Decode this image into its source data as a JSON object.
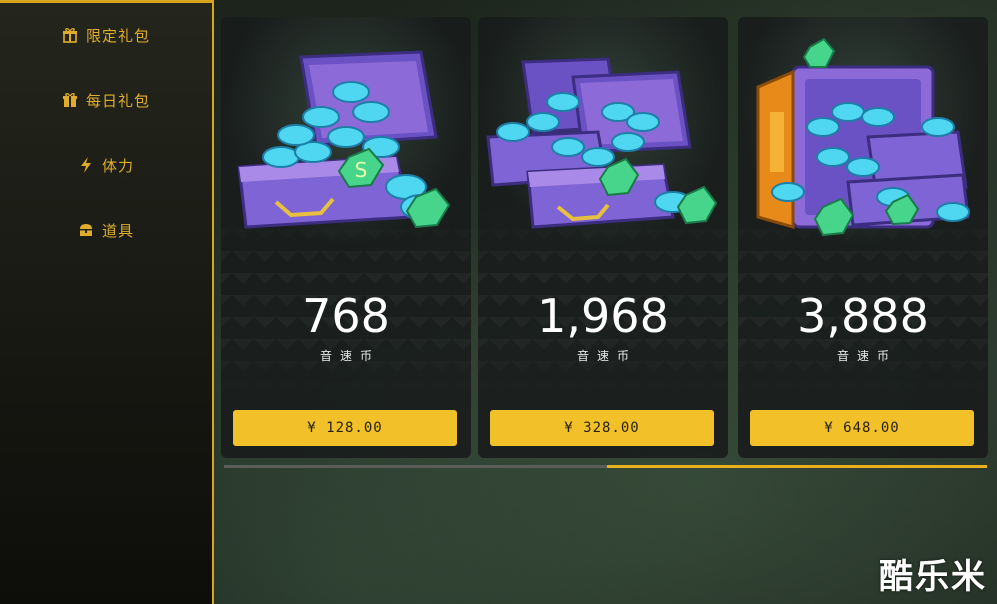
{
  "sidebar": {
    "items": [
      {
        "label": "限定礼包",
        "icon": "gift-box-icon"
      },
      {
        "label": "每日礼包",
        "icon": "gift-icon"
      },
      {
        "label": "体力",
        "icon": "lightning-icon"
      },
      {
        "label": "道具",
        "icon": "chest-icon"
      }
    ]
  },
  "packs": [
    {
      "amount": "768",
      "unit": "音速币",
      "price": "¥ 128.00",
      "art": "coin-chest-single"
    },
    {
      "amount": "1,968",
      "unit": "音速币",
      "price": "¥ 328.00",
      "art": "coin-chest-double"
    },
    {
      "amount": "3,888",
      "unit": "音速币",
      "price": "¥ 648.00",
      "art": "coin-vault"
    }
  ],
  "scroll": {
    "position": 0.5
  },
  "watermark": "酷乐米",
  "colors": {
    "accent": "#d9a521",
    "button": "#f2c12a",
    "coin": "#4fd6f0",
    "chest": "#8c6ad8"
  }
}
